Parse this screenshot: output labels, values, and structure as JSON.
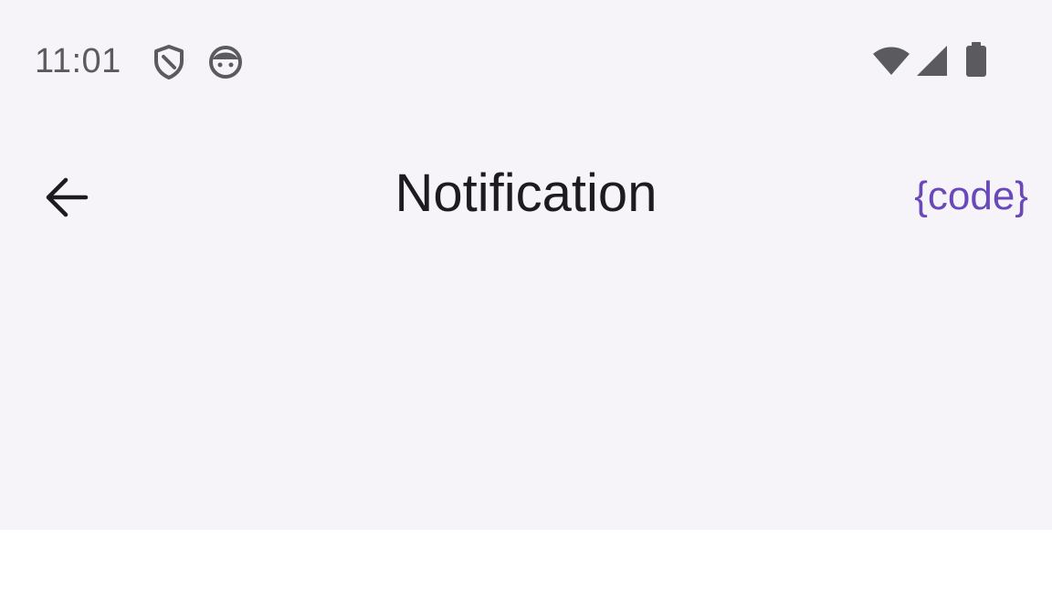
{
  "status_bar": {
    "time": "11:01",
    "icons": [
      "shield-icon",
      "android-face-icon",
      "wifi-icon",
      "cellular-signal-icon",
      "battery-icon"
    ]
  },
  "app_bar": {
    "back_icon": "arrow-back-icon",
    "title": "Notification",
    "action_label": "{code}"
  },
  "colors": {
    "surface": "#f7f4f9",
    "title_text": "#1d1b20",
    "status_text": "#5b5b5f",
    "accent": "#6a48b8",
    "bottom_area": "#ffffff"
  }
}
